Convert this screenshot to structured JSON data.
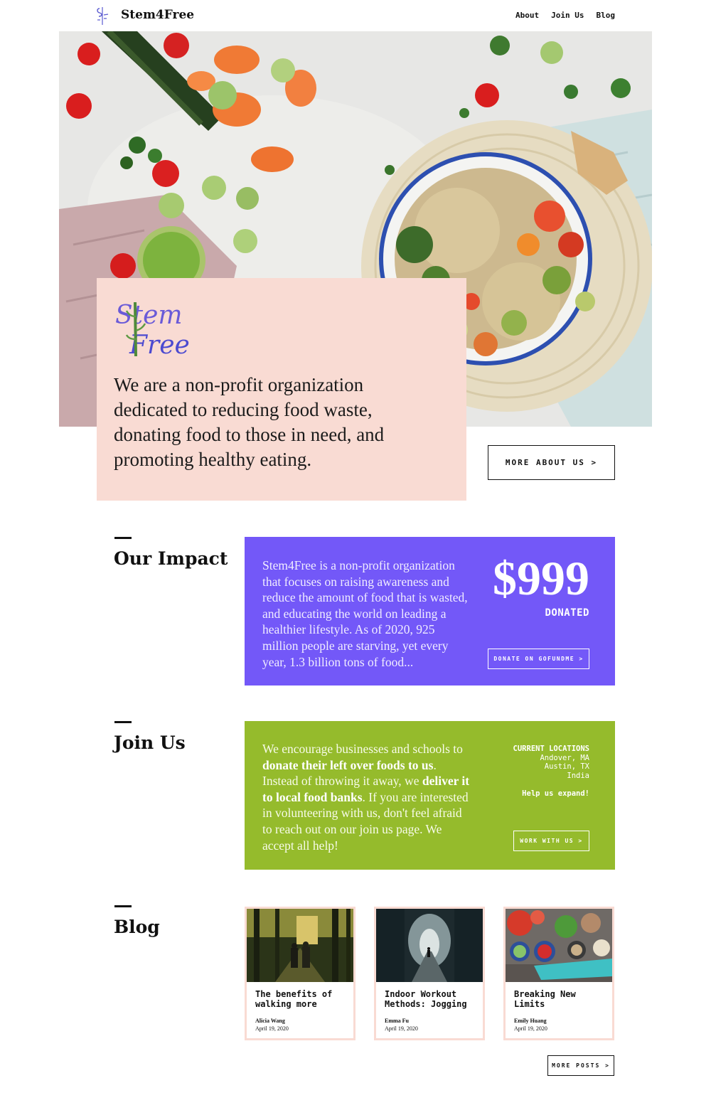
{
  "header": {
    "brand": "Stem4Free",
    "nav": [
      "About",
      "Join Us",
      "Blog"
    ]
  },
  "hero": {
    "logo_text": [
      "Stem",
      "Free"
    ],
    "tagline": "We are a non-profit organization dedicated to reducing food waste, donating food to those in need, and promoting healthy eating.",
    "more_about_button": "MORE ABOUT US >"
  },
  "impact": {
    "title": "Our Impact",
    "body": "Stem4Free is a non-profit organization that focuses on raising awareness and reduce the amount of food that is wasted, and educating the world on leading a healthier lifestyle. As of 2020, 925 million people are starving, yet every year, 1.3 billion tons of food...",
    "amount": "$999",
    "amount_label": "DONATED",
    "donate_button": "DONATE ON GOFUNDME >",
    "color": "#7358f8"
  },
  "join": {
    "title": "Join Us",
    "body_1": "We encourage businesses and schools to ",
    "body_bold_1": "donate their left over foods to us",
    "body_2": ". Instead of throwing it away, we ",
    "body_bold_2": "deliver it to local food banks",
    "body_3": ". If you are interested in volunteering with us, don't feel afraid to reach out on our join us page. We accept all help!",
    "locations_title": "CURRENT LOCATIONS",
    "locations": [
      "Andover, MA",
      "Austin, TX",
      "India"
    ],
    "help_text": "Help us expand!",
    "work_button": "WORK WITH US >",
    "color": "#95bb2c"
  },
  "blog": {
    "title": "Blog",
    "posts": [
      {
        "title": "The benefits of walking more",
        "author": "Alicia Wang",
        "date": "April 19, 2020"
      },
      {
        "title": "Indoor Workout Methods: Jogging",
        "author": "Emma Fu",
        "date": "April 19, 2020"
      },
      {
        "title": "Breaking New Limits",
        "author": "Emily Huang",
        "date": "April 19, 2020"
      }
    ],
    "more_button": "MORE POSTS >"
  }
}
